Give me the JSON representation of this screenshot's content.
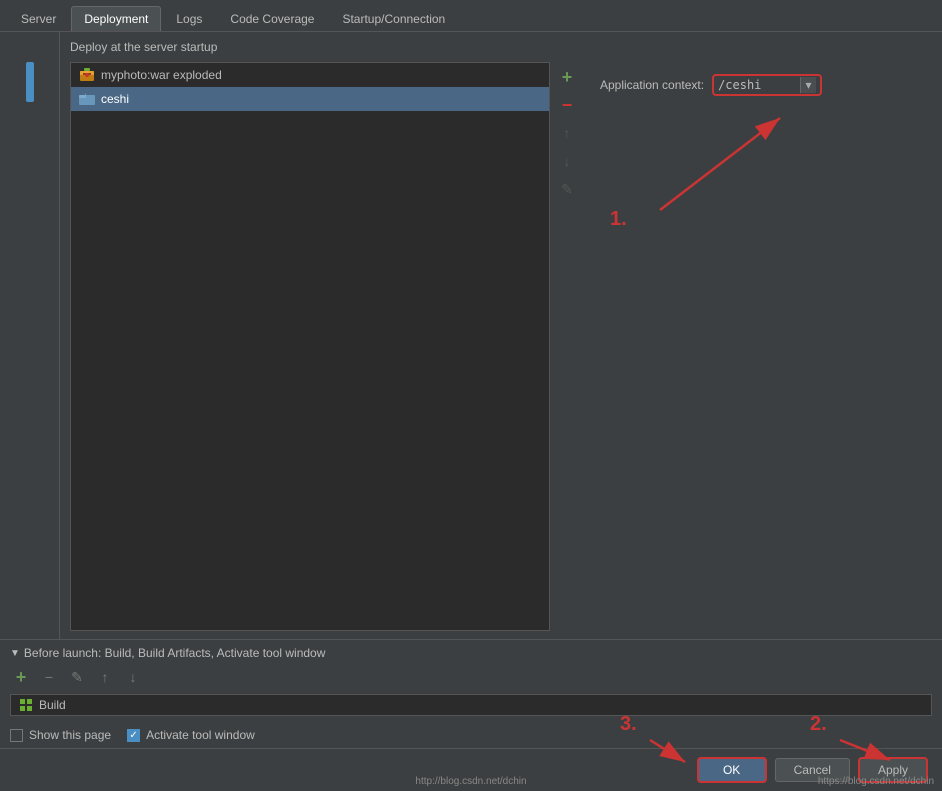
{
  "tabs": [
    {
      "label": "Server",
      "active": false
    },
    {
      "label": "Deployment",
      "active": true
    },
    {
      "label": "Logs",
      "active": false
    },
    {
      "label": "Code Coverage",
      "active": false
    },
    {
      "label": "Startup/Connection",
      "active": false
    }
  ],
  "deploy": {
    "header": "Deploy at the server startup",
    "artifacts": [
      {
        "name": "myphoto:war exploded",
        "type": "war",
        "selected": false
      },
      {
        "name": "ceshi",
        "type": "folder",
        "selected": true
      }
    ],
    "appContextLabel": "Application context:",
    "appContextValue": "/ceshi"
  },
  "beforeLaunch": {
    "header": "Before launch: Build, Build Artifacts, Activate tool window",
    "items": [
      {
        "name": "Build"
      }
    ]
  },
  "bottomOptions": {
    "showThisPage": {
      "label": "Show this page",
      "checked": false
    },
    "activateToolWindow": {
      "label": "Activate tool window",
      "checked": true
    }
  },
  "buttons": {
    "ok": "OK",
    "cancel": "Cancel",
    "apply": "Apply"
  },
  "annotations": {
    "one": "1.",
    "two": "2.",
    "three": "3."
  },
  "icons": {
    "plus": "+",
    "minus": "−",
    "up": "↑",
    "down": "↓",
    "edit": "✎",
    "triangle": "▼",
    "chevron": "▾",
    "check": "✓"
  },
  "watermark": "https://blog.csdn.net/dchin"
}
